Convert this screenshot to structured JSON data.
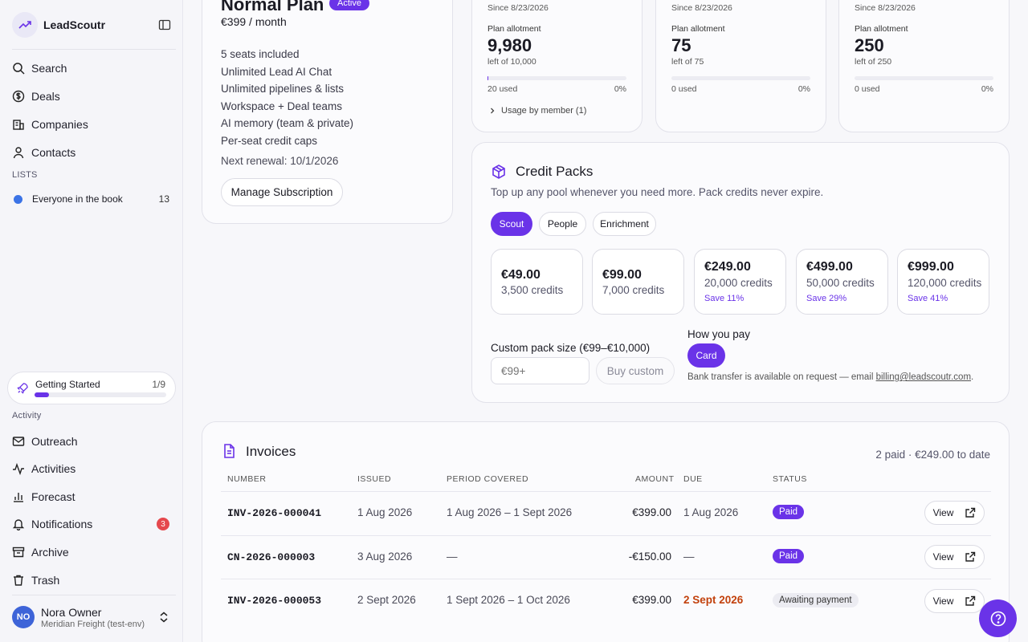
{
  "app": {
    "name": "LeadScoutr",
    "icon": "trend-up-icon"
  },
  "sidebar": {
    "nav": [
      {
        "label": "Search",
        "icon": "search-icon"
      },
      {
        "label": "Deals",
        "icon": "dollar-icon"
      },
      {
        "label": "Companies",
        "icon": "building-icon"
      },
      {
        "label": "Contacts",
        "icon": "user-icon"
      }
    ],
    "lists_heading": "LISTS",
    "lists": [
      {
        "label": "Everyone in the book",
        "count": "13",
        "color": "#3b73e6"
      }
    ],
    "getting_started": {
      "label": "Getting Started",
      "count": "1/9",
      "progress": 0.11
    },
    "activity_heading": "Activity",
    "activity": [
      {
        "label": "Outreach",
        "icon": "mail-icon"
      },
      {
        "label": "Activities",
        "icon": "pulse-icon"
      },
      {
        "label": "Forecast",
        "icon": "bar-chart-icon"
      },
      {
        "label": "Notifications",
        "icon": "bell-icon",
        "badge": "3"
      },
      {
        "label": "Archive",
        "icon": "archive-icon"
      },
      {
        "label": "Trash",
        "icon": "trash-icon"
      }
    ],
    "user": {
      "initials": "NO",
      "name": "Nora Owner",
      "org": "Meridian Freight (test-env)"
    }
  },
  "plan": {
    "title": "Normal Plan",
    "badge": "Active",
    "price": "€399 / month",
    "features": [
      "5 seats included",
      "Unlimited Lead AI Chat",
      "Unlimited pipelines & lists",
      "Workspace + Deal teams",
      "AI memory (team & private)",
      "Per-seat credit caps"
    ],
    "renewal": "Next renewal: 10/1/2026",
    "manage_label": "Manage Subscription"
  },
  "pools": [
    {
      "since": "Since 8/23/2026",
      "allot_label": "Plan allotment",
      "value": "9,980",
      "left": "left of 10,000",
      "used": "20 used",
      "pct": "0%",
      "fill": 0.002,
      "usage": "Usage by member (1)"
    },
    {
      "since": "Since 8/23/2026",
      "allot_label": "Plan allotment",
      "value": "75",
      "left": "left of 75",
      "used": "0 used",
      "pct": "0%",
      "fill": 0
    },
    {
      "since": "Since 8/23/2026",
      "allot_label": "Plan allotment",
      "value": "250",
      "left": "left of 250",
      "used": "0 used",
      "pct": "0%",
      "fill": 0
    }
  ],
  "packs": {
    "title": "Credit Packs",
    "subtitle": "Top up any pool whenever you need more. Pack credits never expire.",
    "tabs": [
      "Scout",
      "People",
      "Enrichment"
    ],
    "active_tab": "Scout",
    "items": [
      {
        "price": "€49.00",
        "credits": "3,500 credits",
        "save": ""
      },
      {
        "price": "€99.00",
        "credits": "7,000 credits",
        "save": ""
      },
      {
        "price": "€249.00",
        "credits": "20,000 credits",
        "save": "Save 11%"
      },
      {
        "price": "€499.00",
        "credits": "50,000 credits",
        "save": "Save 29%"
      },
      {
        "price": "€999.00",
        "credits": "120,000 credits",
        "save": "Save 41%"
      }
    ],
    "custom_label": "Custom pack size (€99–€10,000)",
    "custom_placeholder": "€99+",
    "buy_label": "Buy custom",
    "pay_label": "How you pay",
    "pay_method": "Card",
    "bank_note": "Bank transfer is available on request — email ",
    "bank_email": "billing@leadscoutr.com",
    "bank_note_end": "."
  },
  "invoices": {
    "title": "Invoices",
    "summary": "2 paid · €249.00 to date",
    "headers": {
      "number": "NUMBER",
      "issued": "ISSUED",
      "period": "PERIOD COVERED",
      "amount": "AMOUNT",
      "due": "DUE",
      "status": "STATUS"
    },
    "rows": [
      {
        "number": "INV-2026-000041",
        "issued": "1 Aug 2026",
        "period": "1 Aug 2026 – 1 Sept 2026",
        "amount": "€399.00",
        "due": "1 Aug 2026",
        "status": "Paid",
        "action": "View"
      },
      {
        "number": "CN-2026-000003",
        "issued": "3 Aug 2026",
        "period": "—",
        "amount": "-€150.00",
        "due": "—",
        "status": "Paid",
        "action": "View"
      },
      {
        "number": "INV-2026-000053",
        "issued": "2 Sept 2026",
        "period": "1 Sept 2026 – 1 Oct 2026",
        "amount": "€399.00",
        "due": "2 Sept 2026",
        "status": "Awaiting payment",
        "action": "View"
      }
    ]
  },
  "colors": {
    "accent": "#6a33e8",
    "danger": "#e5484d",
    "overdue": "#c2410c"
  }
}
